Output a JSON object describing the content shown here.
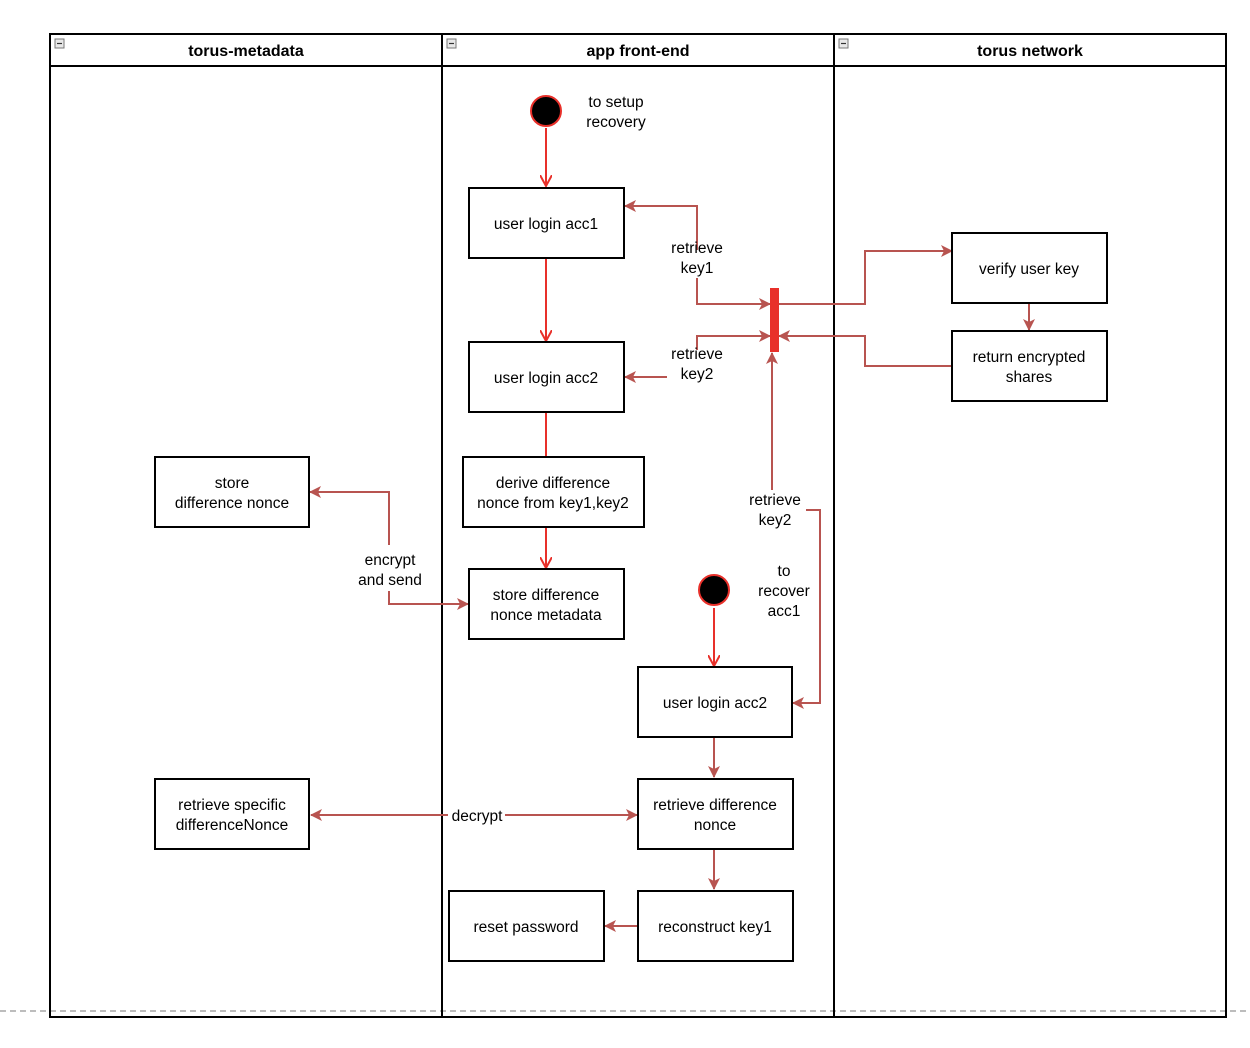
{
  "diagram": {
    "lanes": [
      {
        "id": "lane-metadata",
        "title": "torus-metadata",
        "collapse_icon": "minus-box-icon"
      },
      {
        "id": "lane-frontend",
        "title": "app front-end",
        "collapse_icon": "minus-box-icon"
      },
      {
        "id": "lane-network",
        "title": "torus network",
        "collapse_icon": "minus-box-icon"
      }
    ],
    "start_nodes": [
      {
        "id": "start-setup",
        "label": [
          "to setup",
          "recovery"
        ]
      },
      {
        "id": "start-recover",
        "label": [
          "to",
          "recover",
          "acc1"
        ]
      }
    ],
    "nodes": [
      {
        "id": "login-acc1",
        "lane": "app front-end",
        "lines": [
          "user login acc1"
        ]
      },
      {
        "id": "login-acc2",
        "lane": "app front-end",
        "lines": [
          "user login acc2"
        ]
      },
      {
        "id": "derive-nonce",
        "lane": "app front-end",
        "lines": [
          "derive difference",
          "nonce from key1,key2"
        ]
      },
      {
        "id": "store-nonce-metadata",
        "lane": "app front-end",
        "lines": [
          "store difference",
          "nonce metadata"
        ]
      },
      {
        "id": "store-nonce",
        "lane": "torus-metadata",
        "lines": [
          "store",
          "difference nonce"
        ]
      },
      {
        "id": "verify-key",
        "lane": "torus network",
        "lines": [
          "verify user key"
        ]
      },
      {
        "id": "return-shares",
        "lane": "torus network",
        "lines": [
          "return encrypted",
          "shares"
        ]
      },
      {
        "id": "login-acc2-recover",
        "lane": "app front-end",
        "lines": [
          "user login acc2"
        ]
      },
      {
        "id": "retrieve-nonce",
        "lane": "app front-end",
        "lines": [
          "retrieve difference",
          "nonce"
        ]
      },
      {
        "id": "retrieve-specific",
        "lane": "torus-metadata",
        "lines": [
          "retrieve specific",
          "differenceNonce"
        ]
      },
      {
        "id": "reconstruct-key1",
        "lane": "app front-end",
        "lines": [
          "reconstruct key1"
        ]
      },
      {
        "id": "reset-password",
        "lane": "app front-end",
        "lines": [
          "reset password"
        ]
      }
    ],
    "edge_labels": {
      "retrieve_key1": [
        "retrieve",
        "key1"
      ],
      "retrieve_key2_top": [
        "retrieve",
        "key2"
      ],
      "retrieve_key2_bottom": [
        "retrieve",
        "key2"
      ],
      "encrypt_send": [
        "encrypt",
        "and send"
      ],
      "decrypt": "decrypt"
    },
    "colors": {
      "edge": "#b85450",
      "flow": "#e8302a",
      "sync_bar": "#e8302a",
      "start_fill": "#000000",
      "start_stroke": "#e8302a"
    }
  }
}
